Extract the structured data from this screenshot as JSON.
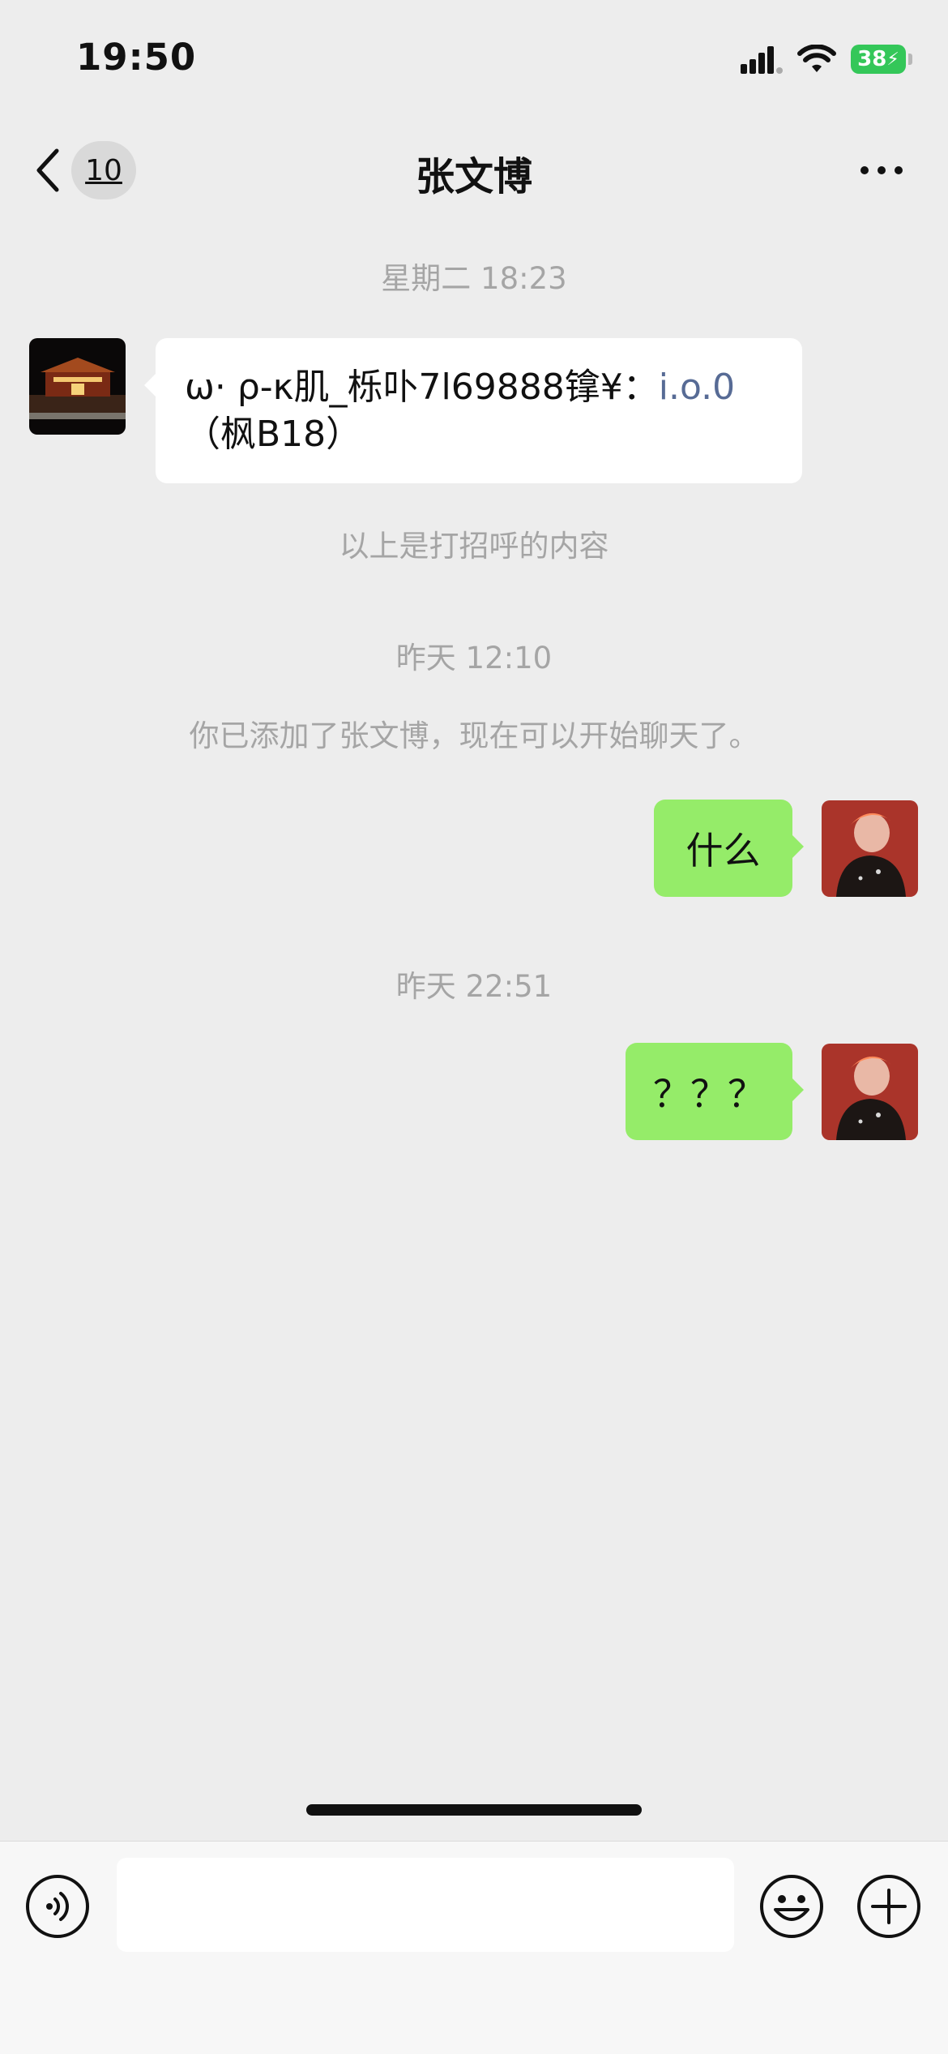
{
  "status_bar": {
    "time": "19:50",
    "battery": "38"
  },
  "nav": {
    "unread_count": "10",
    "title": "张文博"
  },
  "chat": {
    "timestamp_1": "星期二 18:23",
    "greeting_message_a": "ω· ρ-κ肌_栎卟7l69888镎¥：",
    "greeting_message_link": "i.o.0",
    "greeting_message_b": "（枫B18）",
    "greeting_note": "以上是打招呼的内容",
    "timestamp_2": "昨天 12:10",
    "added_notice": "你已添加了张文博，现在可以开始聊天了。",
    "outgoing_1": "什么",
    "timestamp_3": "昨天 22:51",
    "outgoing_2": "？？？"
  },
  "input": {
    "placeholder": ""
  },
  "colors": {
    "background": "#ededed",
    "outgoing_bubble": "#95ec69",
    "link": "#576b95",
    "battery": "#34c759"
  }
}
